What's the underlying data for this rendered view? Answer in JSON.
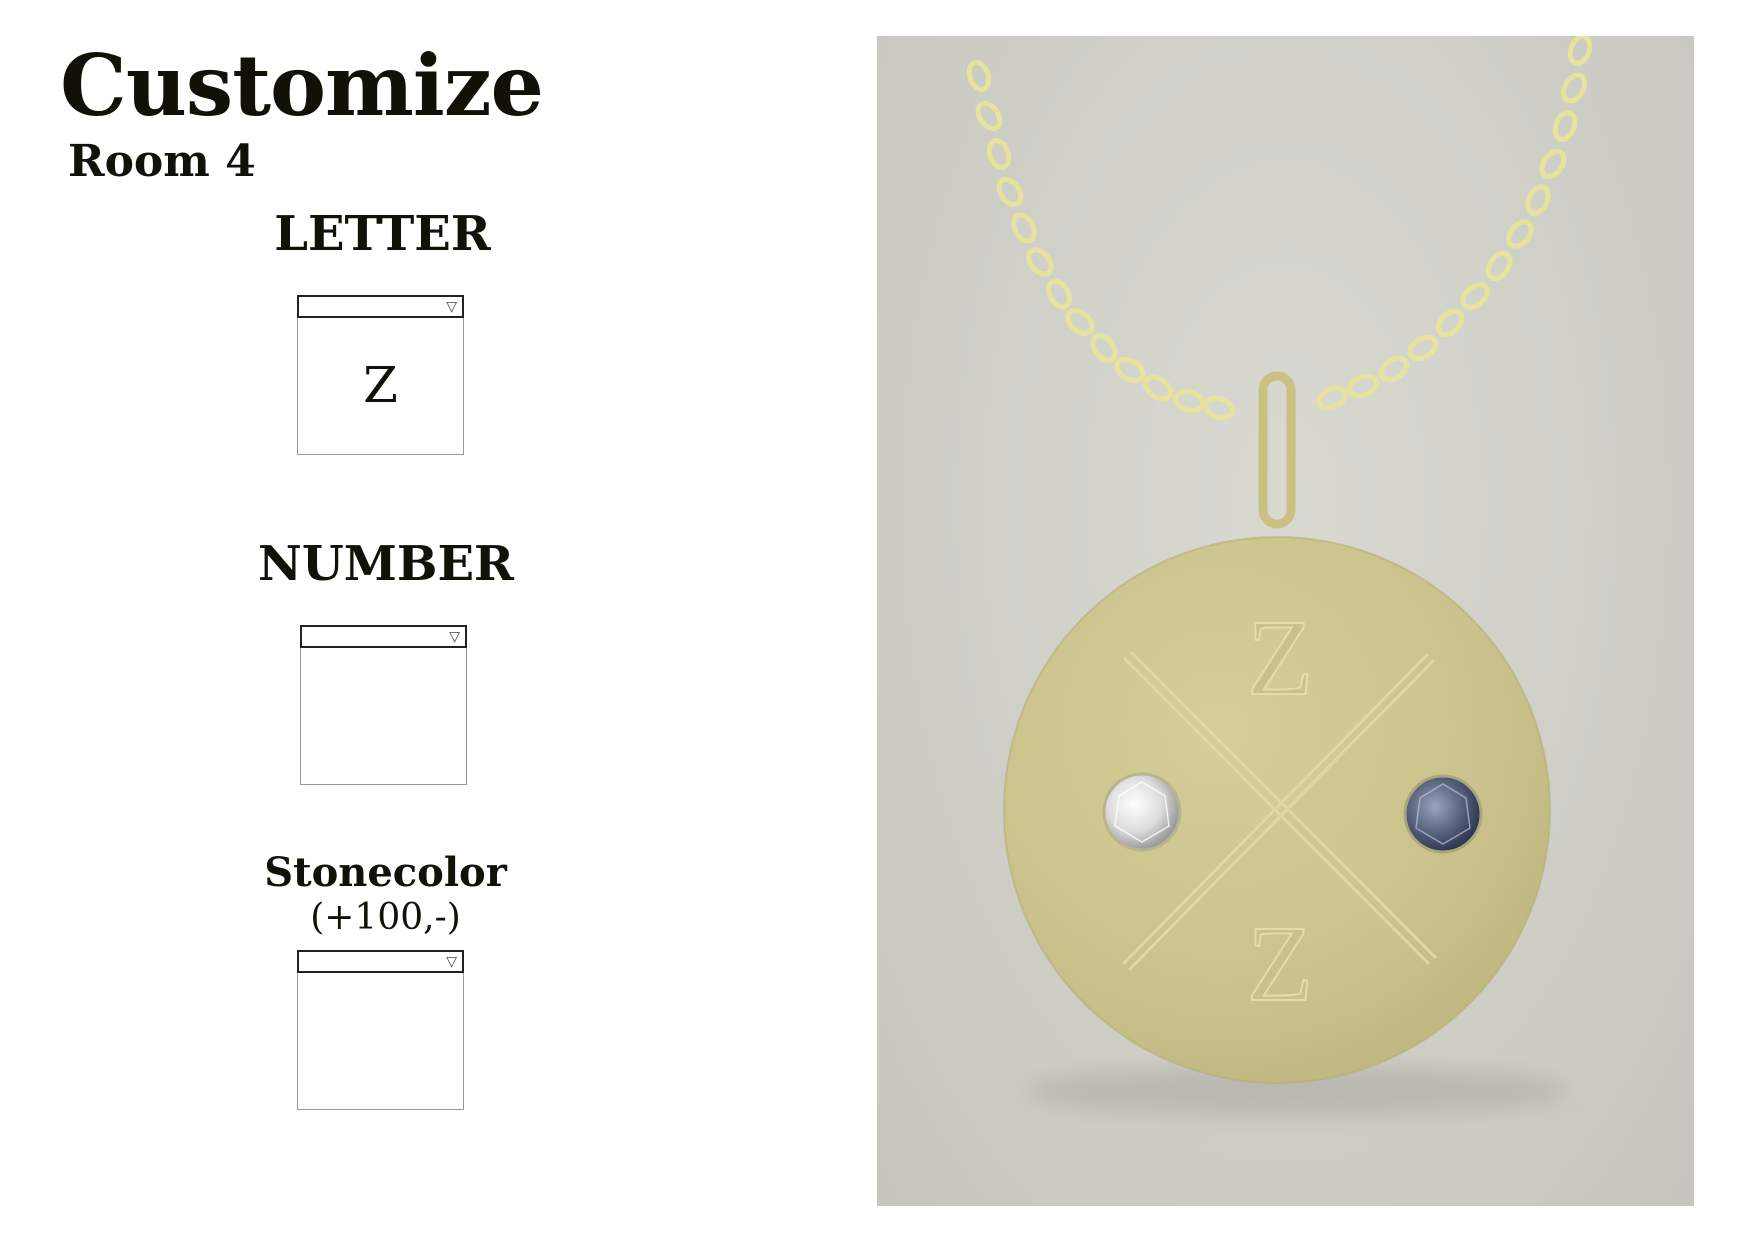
{
  "header": {
    "title": "Customize",
    "subtitle": "Room 4"
  },
  "letter": {
    "label": "LETTER",
    "value": "Z"
  },
  "number": {
    "label": "NUMBER",
    "value": ""
  },
  "stonecolor": {
    "label": "Stonecolor",
    "price": "(+100,-)",
    "value": ""
  },
  "preview": {
    "pendant_letter_top": "Z",
    "pendant_letter_bottom": "Z",
    "metal_color": "#cfc68f",
    "stone_left_color": "#e8e8e8",
    "stone_right_color": "#5a6580"
  },
  "icons": {
    "dropdown": "triangle-down-icon"
  }
}
